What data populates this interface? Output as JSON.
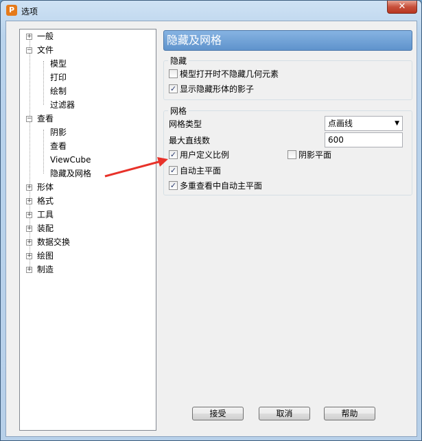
{
  "window": {
    "title": "选项",
    "app_icon_letter": "P",
    "close_symbol": "✕"
  },
  "tree": {
    "items": [
      {
        "label": "一般",
        "level": 0,
        "expander": "+"
      },
      {
        "label": "文件",
        "level": 0,
        "expander": "−"
      },
      {
        "label": "模型",
        "level": 1
      },
      {
        "label": "打印",
        "level": 1
      },
      {
        "label": "绘制",
        "level": 1
      },
      {
        "label": "过滤器",
        "level": 1
      },
      {
        "label": "查看",
        "level": 0,
        "expander": "−"
      },
      {
        "label": "阴影",
        "level": 1
      },
      {
        "label": "查看",
        "level": 1
      },
      {
        "label": "ViewCube",
        "level": 1
      },
      {
        "label": "隐藏及网格",
        "level": 1,
        "selected": true
      },
      {
        "label": "形体",
        "level": 0,
        "expander": "+"
      },
      {
        "label": "格式",
        "level": 0,
        "expander": "+"
      },
      {
        "label": "工具",
        "level": 0,
        "expander": "+"
      },
      {
        "label": "装配",
        "level": 0,
        "expander": "+"
      },
      {
        "label": "数据交换",
        "level": 0,
        "expander": "+"
      },
      {
        "label": "绘图",
        "level": 0,
        "expander": "+"
      },
      {
        "label": "制造",
        "level": 0,
        "expander": "+"
      }
    ]
  },
  "panel": {
    "title": "隐藏及网格",
    "hide_group": {
      "title": "隐藏",
      "options": [
        {
          "label": "模型打开时不隐藏几何元素",
          "checked": false
        },
        {
          "label": "显示隐藏形体的影子",
          "checked": true
        }
      ]
    },
    "grid_group": {
      "title": "网格",
      "grid_type_label": "网格类型",
      "grid_type_value": "点画线",
      "max_lines_label": "最大直线数",
      "max_lines_value": "600",
      "options": [
        {
          "label": "用户定义比例",
          "checked": true
        },
        {
          "label": "阴影平面",
          "checked": false
        },
        {
          "label": "自动主平面",
          "checked": true
        },
        {
          "label": "多重查看中自动主平面",
          "checked": true
        }
      ]
    }
  },
  "buttons": {
    "ok": "接受",
    "cancel": "取消",
    "help": "帮助"
  },
  "colors": {
    "header_bg": "#6f9fd6",
    "annotation_arrow": "#e8322a"
  }
}
